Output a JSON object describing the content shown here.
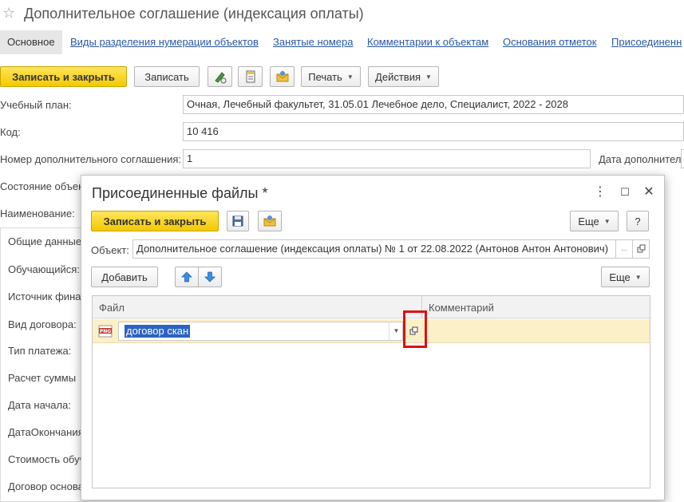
{
  "main": {
    "title": "Дополнительное соглашение (индексация оплаты)",
    "nav": {
      "active": "Основное",
      "links": [
        "Виды разделения нумерации объектов",
        "Занятые номера",
        "Комментарии к объектам",
        "Основания отметок",
        "Присоединенн"
      ]
    },
    "toolbar": {
      "save_close": "Записать и закрыть",
      "save": "Записать",
      "print": "Печать",
      "actions": "Действия"
    },
    "fields": {
      "plan_label": "Учебный план:",
      "plan_value": "Очная, Лечебный факультет, 31.05.01 Лечебное дело, Специалист, 2022 - 2028",
      "code_label": "Код:",
      "code_value": "10 416",
      "number_label": "Номер дополнительного соглашения:",
      "number_value": "1",
      "date_label": "Дата дополнитель",
      "state_label": "Состояние объек",
      "name_label": "Наименование:"
    },
    "left_panel": {
      "items": [
        "Общие данные",
        "Обучающийся:",
        "Источник фина",
        "Вид договора:",
        "Тип платежа:",
        "Расчет суммы",
        "Дата начала:",
        "ДатаОкончания",
        "Стоимость обуч",
        "Договор основа"
      ]
    }
  },
  "dialog": {
    "title": "Присоединенные файлы *",
    "toolbar": {
      "save_close": "Записать и закрыть",
      "more": "Еще",
      "help": "?"
    },
    "object_label": "Объект:",
    "object_value": "Дополнительное соглашение (индексация оплаты) № 1 от 22.08.2022 (Антонов Антон Антонович)",
    "object_ellipsis": "...",
    "add_button": "Добавить",
    "more2": "Еще",
    "grid": {
      "columns": [
        "Файл",
        "Комментарий"
      ],
      "rows": [
        {
          "file_type": "PNG",
          "file": "договор скан",
          "comment": ""
        }
      ]
    }
  },
  "colors": {
    "accent_yellow": "#f3c900",
    "link": "#2a58a6",
    "row_highlight": "#fbf0c7",
    "selection": "#2b63c5",
    "annotation_red": "#e01010"
  }
}
